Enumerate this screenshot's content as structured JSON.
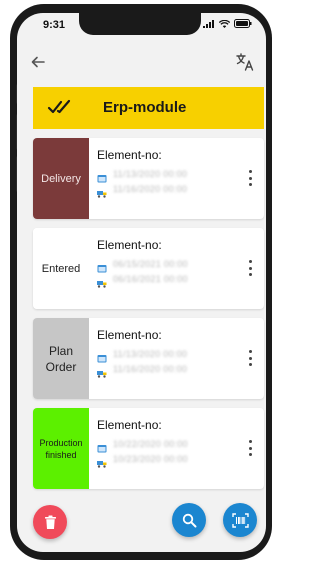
{
  "status_bar": {
    "time": "9:31"
  },
  "toolbar": {
    "back_icon": "arrow-left-icon",
    "translate_icon": "translate-icon"
  },
  "banner": {
    "title": "Erp-module",
    "color": "#f7d000"
  },
  "cards": [
    {
      "status": "Delivery",
      "status_color": "#7b3a3a",
      "status_text_color": "#f3e6e6",
      "label": "Element-no:",
      "date1": "11/13/2020 00:00",
      "date2": "11/16/2020 00:00"
    },
    {
      "status": "Entered",
      "status_color": "#ffffff",
      "status_text_color": "#222222",
      "label": "Element-no:",
      "date1": "06/15/2021 00:00",
      "date2": "06/16/2021 00:00"
    },
    {
      "status": "Plan Order",
      "status_color": "#c6c6c6",
      "status_text_color": "#222222",
      "label": "Element-no:",
      "date1": "11/13/2020 00:00",
      "date2": "11/16/2020 00:00"
    },
    {
      "status": "Production finished",
      "status_color": "#5cf000",
      "status_text_color": "#1a1a1a",
      "label": "Element-no:",
      "date1": "10/22/2020 00:00",
      "date2": "10/23/2020 00:00"
    }
  ],
  "fabs": {
    "delete_color": "#f04a5a",
    "search_color": "#1b86d0",
    "scan_color": "#1b86d0"
  }
}
